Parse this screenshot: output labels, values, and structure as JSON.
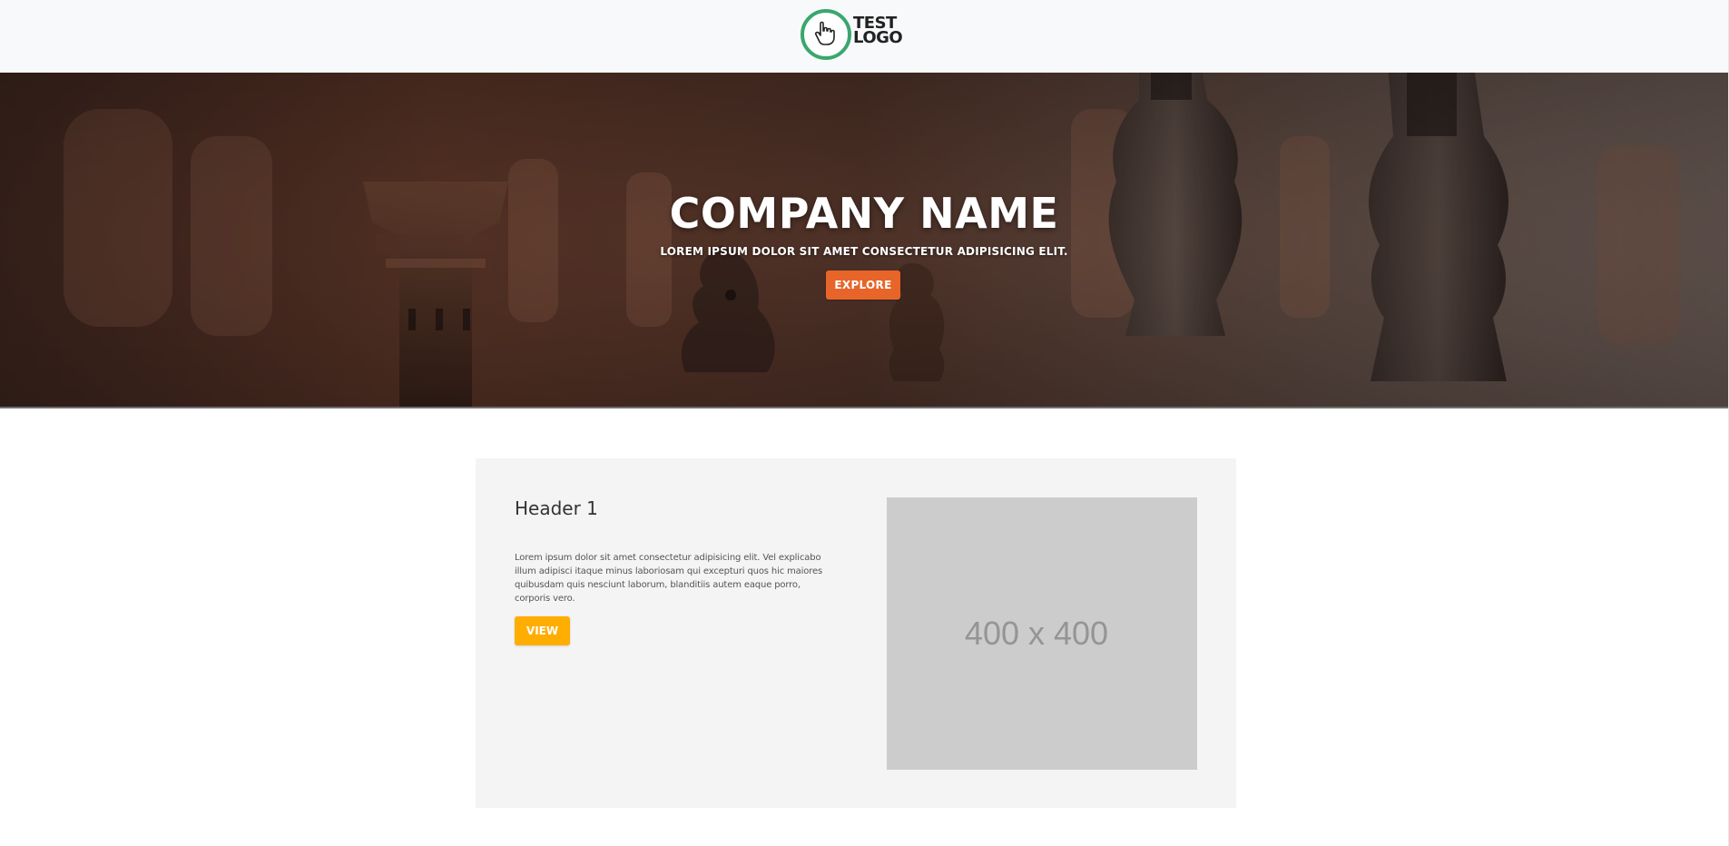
{
  "brand": {
    "logo_text_line1": "TEST",
    "logo_text_line2": "LOGO",
    "logo_icon": "hand-pointer-icon",
    "logo_color": "#3aa76d"
  },
  "hero": {
    "title": "COMPANY NAME",
    "subtitle": "LOREM IPSUM DOLOR SIT AMET CONSECTETUR ADIPISICING ELIT.",
    "button_label": "EXPLORE",
    "button_color": "#e8652a"
  },
  "section": {
    "title": "Header 1",
    "text": "Lorem ipsum dolor sit amet consectetur adipisicing elit. Vel explicabo illum adipisci itaque minus laboriosam qui excepturi quos hic maiores quibusdam quis nesciunt laborum, blanditiis autem eaque porro, corporis vero.",
    "button_label": "VIEW",
    "button_color": "#ffad00",
    "image_placeholder": "400 x 400"
  }
}
